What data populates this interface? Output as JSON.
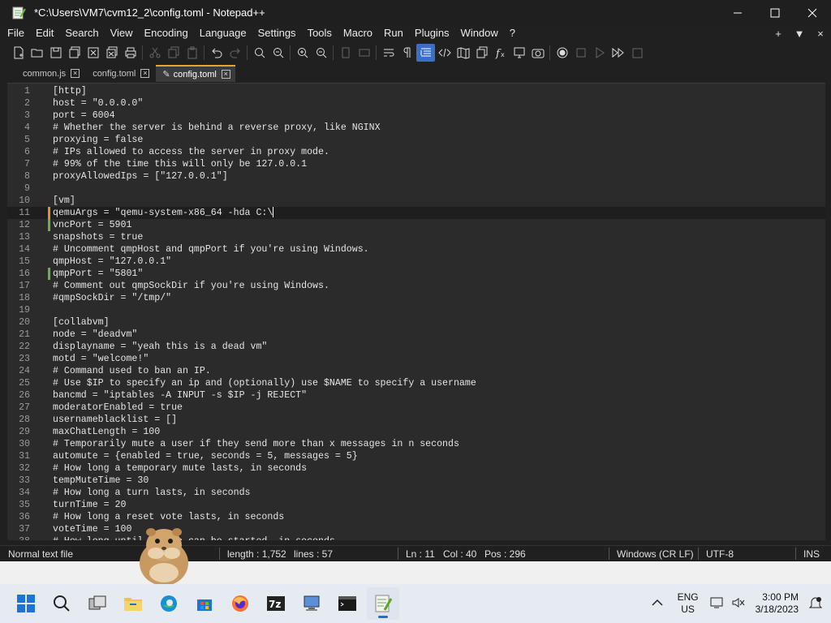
{
  "window": {
    "title": "*C:\\Users\\VM7\\cvm12_2\\config.toml - Notepad++",
    "controls": [
      "minimize-icon",
      "maximize-icon",
      "close-icon"
    ]
  },
  "menu": {
    "items": [
      "File",
      "Edit",
      "Search",
      "View",
      "Encoding",
      "Language",
      "Settings",
      "Tools",
      "Macro",
      "Run",
      "Plugins",
      "Window",
      "?"
    ],
    "right": [
      "+",
      "▼",
      "×"
    ]
  },
  "tabs": [
    {
      "label": "common.js",
      "active": false
    },
    {
      "label": "config.toml",
      "active": false
    },
    {
      "label": "config.toml",
      "active": true
    }
  ],
  "editor": {
    "current_line": 11,
    "lines": [
      "[http]",
      "host = \"0.0.0.0\"",
      "port = 6004",
      "# Whether the server is behind a reverse proxy, like NGINX",
      "proxying = false",
      "# IPs allowed to access the server in proxy mode.",
      "# 99% of the time this will only be 127.0.0.1",
      "proxyAllowedIps = [\"127.0.0.1\"]",
      "",
      "[vm]",
      "qemuArgs = \"qemu-system-x86_64 -hda C:\\",
      "vncPort = 5901",
      "snapshots = true",
      "# Uncomment qmpHost and qmpPort if you're using Windows.",
      "qmpHost = \"127.0.0.1\"",
      "qmpPort = \"5801\"",
      "# Comment out qmpSockDir if you're using Windows.",
      "#qmpSockDir = \"/tmp/\"",
      "",
      "[collabvm]",
      "node = \"deadvm\"",
      "displayname = \"yeah this is a dead vm\"",
      "motd = \"welcome!\"",
      "# Command used to ban an IP.",
      "# Use $IP to specify an ip and (optionally) use $NAME to specify a username",
      "bancmd = \"iptables -A INPUT -s $IP -j REJECT\"",
      "moderatorEnabled = true",
      "usernameblacklist = []",
      "maxChatLength = 100",
      "# Temporarily mute a user if they send more than x messages in n seconds",
      "automute = {enabled = true, seconds = 5, messages = 5}",
      "# How long a temporary mute lasts, in seconds",
      "tempMuteTime = 30",
      "# How long a turn lasts, in seconds",
      "turnTime = 20",
      "# How long a reset vote lasts, in seconds",
      "voteTime = 100",
      "# How long until a vote can be started, in seconds"
    ]
  },
  "status": {
    "type": "Normal text file",
    "length": "length : 1,752",
    "lines": "lines : 57",
    "ln": "Ln : 11",
    "col": "Col : 40",
    "pos": "Pos : 296",
    "eol": "Windows (CR LF)",
    "encoding": "UTF-8",
    "mode": "INS"
  },
  "taskbar": {
    "lang_top": "ENG",
    "lang_bottom": "US",
    "time": "3:00 PM",
    "date": "3/18/2023"
  },
  "colors": {
    "accent": "#2a6bd1",
    "editor_bg": "#2b2b2b",
    "tab_active_border": "#f0a030"
  }
}
